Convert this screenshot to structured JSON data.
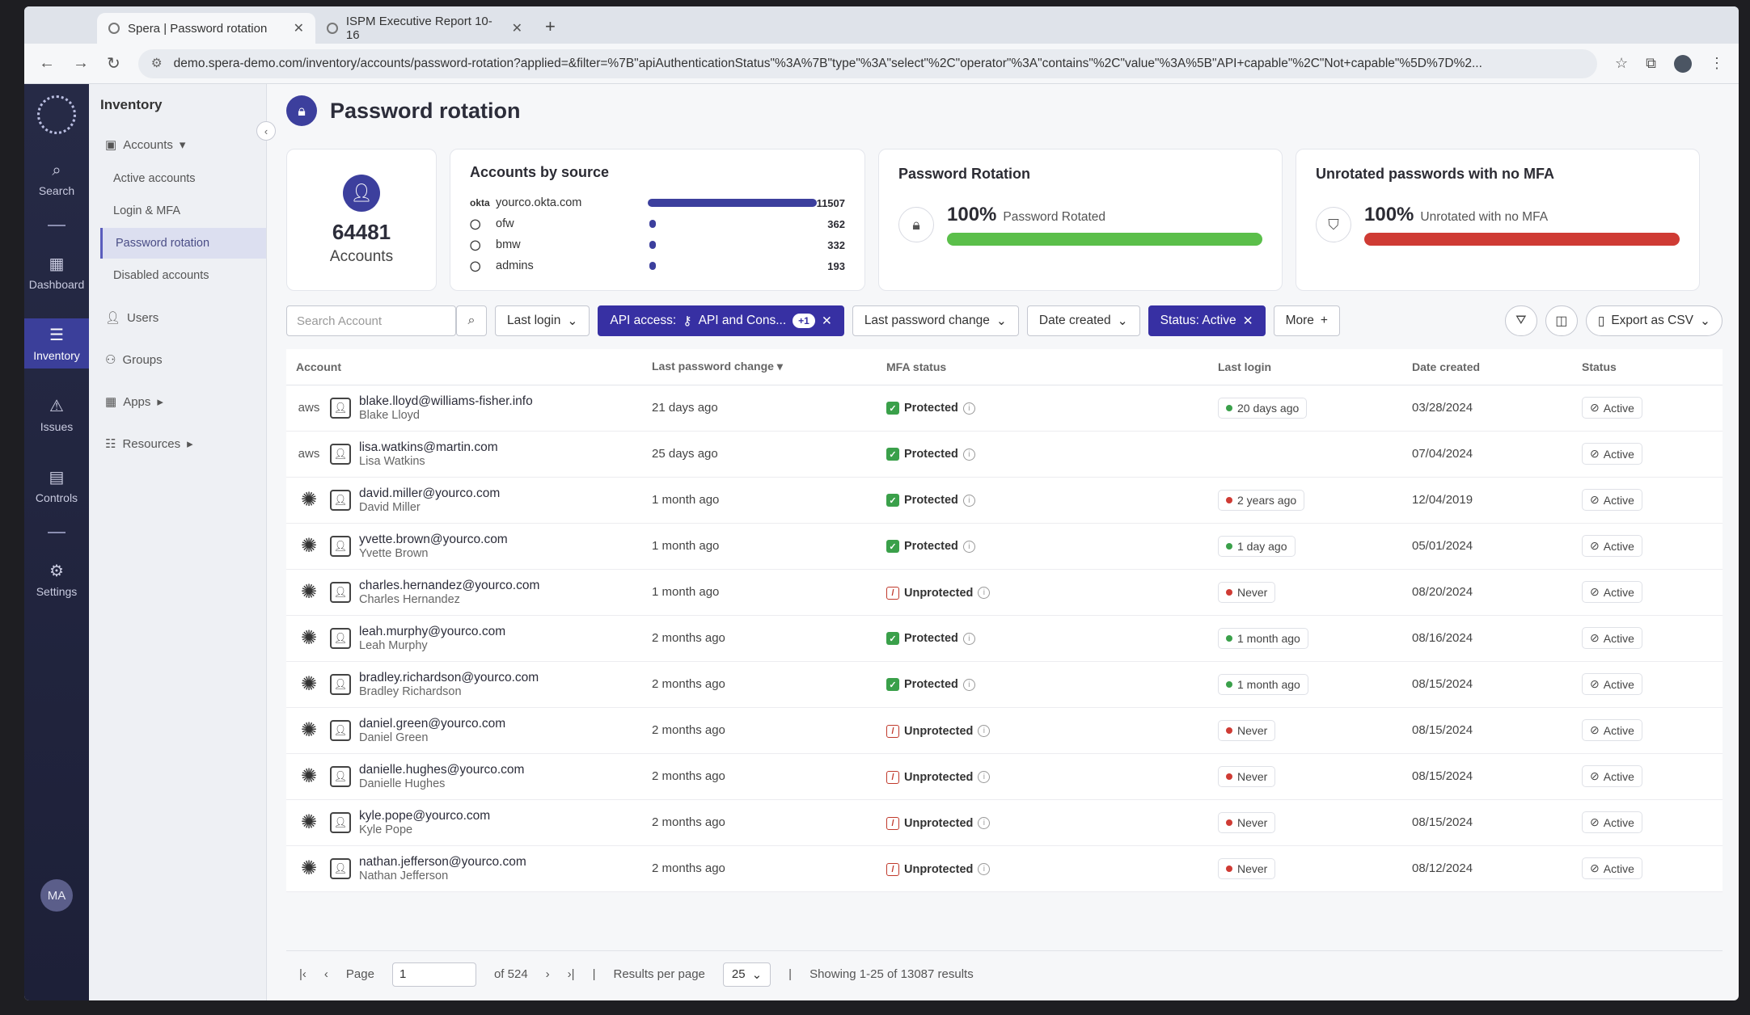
{
  "browser": {
    "tabs": [
      {
        "label": "Spera | Password rotation",
        "active": true
      },
      {
        "label": "ISPM Executive Report 10-16",
        "active": false
      }
    ],
    "url": "demo.spera-demo.com/inventory/accounts/password-rotation?applied=&filter=%7B\"apiAuthenticationStatus\"%3A%7B\"type\"%3A\"select\"%2C\"operator\"%3A\"contains\"%2C\"value\"%3A%5B\"API+capable\"%2C\"Not+capable\"%5D%7D%2..."
  },
  "rail": {
    "items": [
      {
        "label": "Search",
        "icon": "search-icon"
      },
      {
        "label": "Dashboard",
        "icon": "dashboard-icon"
      },
      {
        "label": "Inventory",
        "icon": "inventory-icon",
        "active": true
      },
      {
        "label": "Issues",
        "icon": "warning-icon"
      },
      {
        "label": "Controls",
        "icon": "document-icon"
      },
      {
        "label": "Settings",
        "icon": "gear-icon"
      }
    ],
    "avatar": "MA"
  },
  "subnav": {
    "title": "Inventory",
    "accounts": "Accounts",
    "sub": [
      "Active accounts",
      "Login & MFA",
      "Password rotation",
      "Disabled accounts"
    ],
    "items": [
      "Users",
      "Groups",
      "Apps",
      "Resources"
    ]
  },
  "page": {
    "title": "Password rotation"
  },
  "cards": {
    "total": {
      "value": "64481",
      "label": "Accounts"
    },
    "source": {
      "title": "Accounts by source",
      "rows": [
        {
          "icon": "okta",
          "name": "yourco.okta.com",
          "value": "11507",
          "fraction": 1.0
        },
        {
          "icon": "github",
          "name": "ofw",
          "value": "362",
          "fraction": 0.03
        },
        {
          "icon": "github",
          "name": "bmw",
          "value": "332",
          "fraction": 0.03
        },
        {
          "icon": "github",
          "name": "admins",
          "value": "193",
          "fraction": 0.02
        }
      ]
    },
    "rotation": {
      "title": "Password Rotation",
      "value": "100%",
      "label": "Password Rotated",
      "fraction": 1.0,
      "color": "#5bbf4a"
    },
    "mfa": {
      "title": "Unrotated passwords with no MFA",
      "value": "100%",
      "label": "Unrotated with no MFA",
      "fraction": 1.0,
      "color": "#cf3b34"
    }
  },
  "toolbar": {
    "search_placeholder": "Search Account",
    "last_login": "Last login",
    "api_access": "API access:",
    "api_value": "API and Cons...",
    "api_more": "+1",
    "last_pw": "Last password change",
    "date_created": "Date created",
    "status": "Status: Active",
    "more": "More",
    "export": "Export as CSV"
  },
  "table": {
    "headers": {
      "account": "Account",
      "last_pw": "Last password change",
      "mfa": "MFA status",
      "last_login": "Last login",
      "created": "Date created",
      "status": "Status"
    },
    "rows": [
      {
        "provider": "aws",
        "email": "blake.lloyd@williams-fisher.info",
        "name": "Blake Lloyd",
        "last_pw": "21 days ago",
        "mfa": "Protected",
        "login": "20 days ago",
        "login_color": "#3aa04a",
        "created": "03/28/2024",
        "status": "Active"
      },
      {
        "provider": "aws",
        "email": "lisa.watkins@martin.com",
        "name": "Lisa Watkins",
        "last_pw": "25 days ago",
        "mfa": "Protected",
        "login": "",
        "login_color": "",
        "created": "07/04/2024",
        "status": "Active"
      },
      {
        "provider": "okta",
        "email": "david.miller@yourco.com",
        "name": "David Miller",
        "last_pw": "1 month ago",
        "mfa": "Protected",
        "login": "2 years ago",
        "login_color": "#cf3b34",
        "created": "12/04/2019",
        "status": "Active"
      },
      {
        "provider": "okta",
        "email": "yvette.brown@yourco.com",
        "name": "Yvette Brown",
        "last_pw": "1 month ago",
        "mfa": "Protected",
        "login": "1 day ago",
        "login_color": "#3aa04a",
        "created": "05/01/2024",
        "status": "Active"
      },
      {
        "provider": "okta",
        "email": "charles.hernandez@yourco.com",
        "name": "Charles Hernandez",
        "last_pw": "1 month ago",
        "mfa": "Unprotected",
        "login": "Never",
        "login_color": "#cf3b34",
        "created": "08/20/2024",
        "status": "Active"
      },
      {
        "provider": "okta",
        "email": "leah.murphy@yourco.com",
        "name": "Leah Murphy",
        "last_pw": "2 months ago",
        "mfa": "Protected",
        "login": "1 month ago",
        "login_color": "#3aa04a",
        "created": "08/16/2024",
        "status": "Active"
      },
      {
        "provider": "okta",
        "email": "bradley.richardson@yourco.com",
        "name": "Bradley Richardson",
        "last_pw": "2 months ago",
        "mfa": "Protected",
        "login": "1 month ago",
        "login_color": "#3aa04a",
        "created": "08/15/2024",
        "status": "Active"
      },
      {
        "provider": "okta",
        "email": "daniel.green@yourco.com",
        "name": "Daniel Green",
        "last_pw": "2 months ago",
        "mfa": "Unprotected",
        "login": "Never",
        "login_color": "#cf3b34",
        "created": "08/15/2024",
        "status": "Active"
      },
      {
        "provider": "okta",
        "email": "danielle.hughes@yourco.com",
        "name": "Danielle Hughes",
        "last_pw": "2 months ago",
        "mfa": "Unprotected",
        "login": "Never",
        "login_color": "#cf3b34",
        "created": "08/15/2024",
        "status": "Active"
      },
      {
        "provider": "okta",
        "email": "kyle.pope@yourco.com",
        "name": "Kyle Pope",
        "last_pw": "2 months ago",
        "mfa": "Unprotected",
        "login": "Never",
        "login_color": "#cf3b34",
        "created": "08/15/2024",
        "status": "Active"
      },
      {
        "provider": "okta",
        "email": "nathan.jefferson@yourco.com",
        "name": "Nathan Jefferson",
        "last_pw": "2 months ago",
        "mfa": "Unprotected",
        "login": "Never",
        "login_color": "#cf3b34",
        "created": "08/12/2024",
        "status": "Active"
      }
    ]
  },
  "pager": {
    "page_label": "Page",
    "page": "1",
    "of": "of 524",
    "per_page_label": "Results per page",
    "per_page": "25",
    "showing": "Showing 1-25 of 13087 results"
  }
}
